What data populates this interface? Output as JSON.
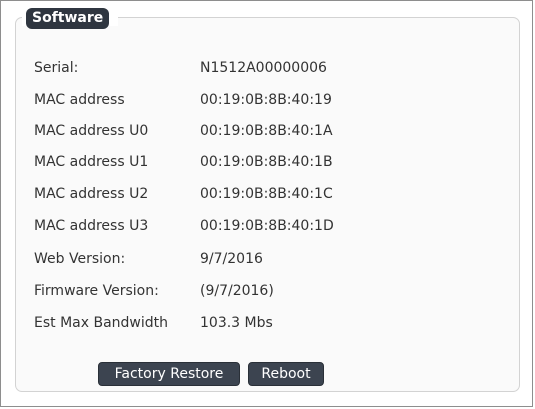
{
  "panel": {
    "title": "Software"
  },
  "info": [
    {
      "label": "Serial:",
      "value": "N1512A00000006"
    },
    {
      "label": "MAC address",
      "value": "00:19:0B:8B:40:19"
    },
    {
      "label": "MAC address U0",
      "value": "00:19:0B:8B:40:1A"
    },
    {
      "label": "MAC address U1",
      "value": "00:19:0B:8B:40:1B"
    },
    {
      "label": "MAC address U2",
      "value": "00:19:0B:8B:40:1C"
    },
    {
      "label": "MAC address U3",
      "value": "00:19:0B:8B:40:1D"
    },
    {
      "label": "Web Version:",
      "value": "9/7/2016"
    },
    {
      "label": "Firmware Version:",
      "value": "(9/7/2016)"
    },
    {
      "label": "Est Max Bandwidth",
      "value": "103.3 Mbs"
    }
  ],
  "actions": {
    "factory_restore_label": "Factory Restore",
    "reboot_label": "Reboot"
  },
  "colors": {
    "legend_bg": "#2f3640",
    "button_bg": "#3c4450",
    "panel_bg": "#fafafa",
    "text": "#333333"
  }
}
